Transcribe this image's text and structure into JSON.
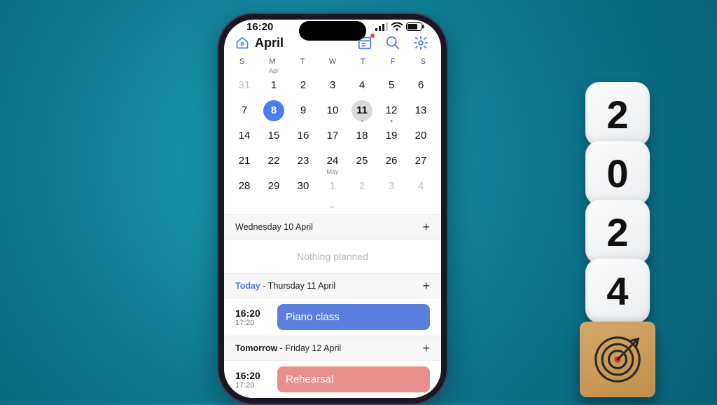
{
  "status": {
    "time": "16:20"
  },
  "header": {
    "title": "April"
  },
  "weekdays": [
    "S",
    "M",
    "T",
    "W",
    "T",
    "F",
    "S"
  ],
  "calendar": {
    "month_label_start": "Apr",
    "month_label_end": "May",
    "rows": [
      [
        {
          "n": "31",
          "fade": true
        },
        {
          "n": "1",
          "mlabel": "start"
        },
        {
          "n": "2"
        },
        {
          "n": "3"
        },
        {
          "n": "4"
        },
        {
          "n": "5"
        },
        {
          "n": "6"
        }
      ],
      [
        {
          "n": "7"
        },
        {
          "n": "8",
          "selected": true
        },
        {
          "n": "9"
        },
        {
          "n": "10"
        },
        {
          "n": "11",
          "today": true,
          "dot": "gray"
        },
        {
          "n": "12",
          "dot": "red"
        },
        {
          "n": "13"
        }
      ],
      [
        {
          "n": "14"
        },
        {
          "n": "15"
        },
        {
          "n": "16"
        },
        {
          "n": "17"
        },
        {
          "n": "18"
        },
        {
          "n": "19"
        },
        {
          "n": "20"
        }
      ],
      [
        {
          "n": "21"
        },
        {
          "n": "22"
        },
        {
          "n": "23"
        },
        {
          "n": "24"
        },
        {
          "n": "25"
        },
        {
          "n": "26"
        },
        {
          "n": "27"
        }
      ],
      [
        {
          "n": "28"
        },
        {
          "n": "29"
        },
        {
          "n": "30"
        },
        {
          "n": "1",
          "fade": true,
          "mlabel": "end"
        },
        {
          "n": "2",
          "fade": true
        },
        {
          "n": "3",
          "fade": true
        },
        {
          "n": "4",
          "fade": true
        }
      ]
    ]
  },
  "agenda": {
    "sections": [
      {
        "title_full": "Wednesday 10 April",
        "empty_text": "Nothing planned",
        "events": []
      },
      {
        "prefix": "Today",
        "dash": " - ",
        "suffix": "Thursday 11 April",
        "events": [
          {
            "start": "16:20",
            "end": "17:20",
            "title": "Piano class",
            "color": "#5b7fdc"
          }
        ]
      },
      {
        "prefix": "Tomorrow",
        "dash": " - ",
        "suffix": "Friday 12 April",
        "events": [
          {
            "start": "16:20",
            "end": "17:20",
            "title": "Rehearsal",
            "color": "#e88f8a"
          }
        ]
      }
    ]
  },
  "decor": {
    "year_digits": [
      "2",
      "0",
      "2",
      "4"
    ]
  }
}
